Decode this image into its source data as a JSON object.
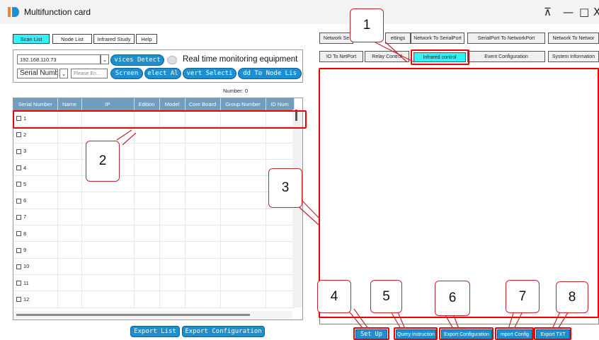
{
  "window": {
    "title": "Multifunction card",
    "pin_glyph": "⊼",
    "minimize_glyph": "—",
    "maximize_glyph": "□",
    "close_glyph": "X"
  },
  "left_tabs": [
    "Scan List",
    "Node List",
    "Infrared Study",
    "Help"
  ],
  "scan": {
    "ip_value": "192.168.110.73",
    "devices_detect_label": "vices Detect",
    "realtime_label": "Real time monitoring equipment",
    "serial_select_value": "Serial Numb",
    "search_placeholder": "Please En...",
    "screen_label": "Screen",
    "select_all_label": "elect Al",
    "invert_label": "vert Selecti",
    "add_node_label": "dd To Node Lis",
    "number_text": "Number: 0"
  },
  "table": {
    "columns": [
      "Serial Number",
      "Name",
      "IP",
      "Edition",
      "Model",
      "Core Board",
      "Group Number",
      "ID Num"
    ],
    "rows": [
      "1",
      "2",
      "3",
      "4",
      "5",
      "6",
      "7",
      "8",
      "9",
      "10",
      "11",
      "12"
    ]
  },
  "bottom_left": {
    "export_list": "Export List",
    "export_config": "Export Configuration"
  },
  "right_tabs_row1": [
    "Network Se",
    "ettings",
    "Network To SerialPort",
    "SerialPort To NetworkPort",
    "Network To Networ"
  ],
  "right_tabs_row2": [
    "IO To NetPort",
    "Relay Control",
    "Infrared control",
    "Event Configuration",
    "System Information"
  ],
  "bottom_right": [
    "Set Up",
    "Query instruction",
    "Export Configuration",
    "mport Config",
    "Export TXT"
  ],
  "callouts": [
    "1",
    "2",
    "3",
    "4",
    "5",
    "6",
    "7",
    "8"
  ],
  "colors": {
    "accent": "#1c8fd1",
    "active_tab": "#33f3f8",
    "header": "#6f9ec1",
    "highlight": "#e00000"
  }
}
